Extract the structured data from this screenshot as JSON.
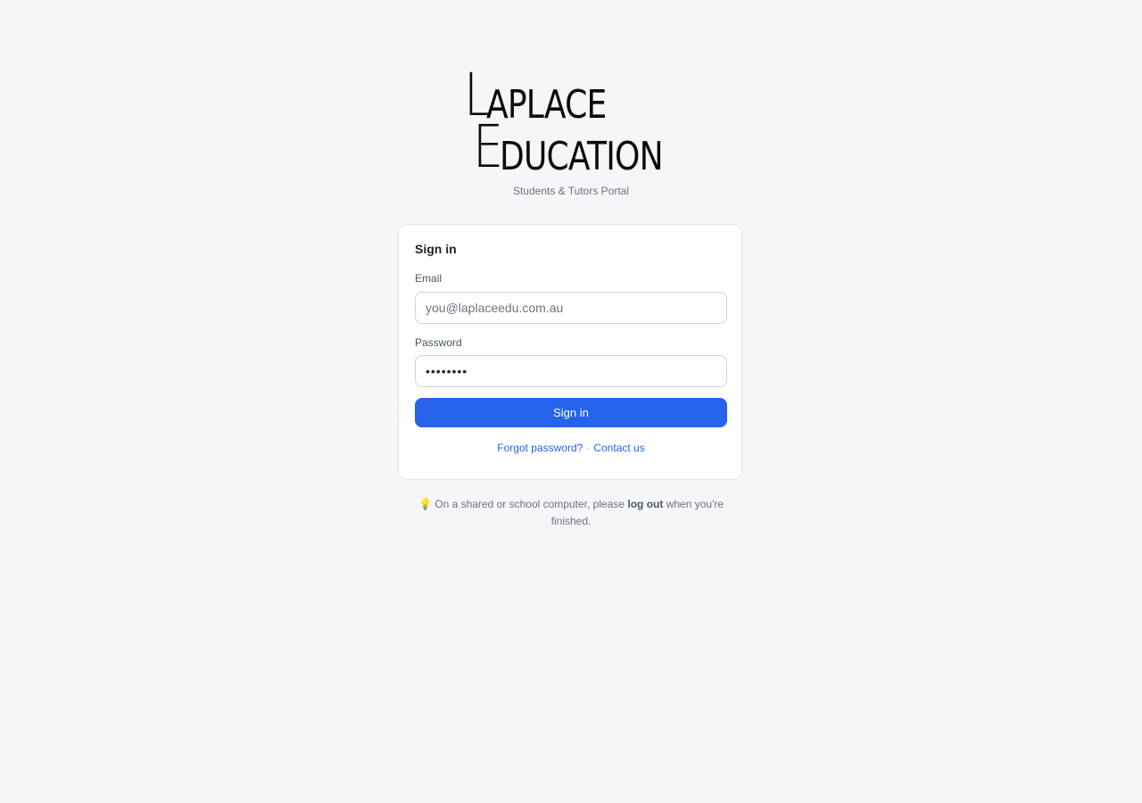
{
  "logo": {
    "line1_initial": "L",
    "line1_rest": "APLACE",
    "line2_initial": "E",
    "line2_rest": "DUCATION"
  },
  "subtitle": "Students & Tutors Portal",
  "signin": {
    "title": "Sign in",
    "email": {
      "label": "Email",
      "placeholder": "you@laplaceedu.com.au",
      "value": ""
    },
    "password": {
      "label": "Password",
      "value": "••••••••"
    },
    "submit_label": "Sign in",
    "forgot_label": "Forgot password?",
    "separator": "·",
    "contact_label": "Contact us"
  },
  "notice": {
    "icon": "lightbulb-icon",
    "text_before": "On a shared or school computer, please",
    "emphasis": "log out",
    "text_after": "when you're finished."
  },
  "colors": {
    "accent": "#2563eb",
    "background": "#f5f6f8"
  }
}
